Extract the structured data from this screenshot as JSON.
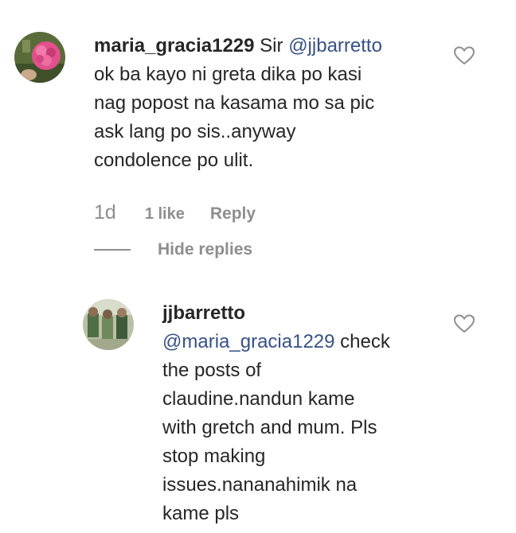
{
  "comments": [
    {
      "username": "maria_gracia1229",
      "mention": "@jjbarretto",
      "prefix": "Sir",
      "body_after_mention_lines": [
        "ok ba kayo ni greta dika po kasi",
        "nag popost na kasama mo sa pic",
        "ask lang po sis..anyway",
        "condolence po ulit."
      ],
      "time": "1d",
      "likes": "1 like",
      "reply_label": "Reply",
      "hide_replies_label": "Hide replies",
      "avatar_icon": "pink-flower-photo"
    },
    {
      "username": "jjbarretto",
      "mention": "@maria_gracia1229",
      "first_line_after_mention": "check",
      "body_lines": [
        "the posts of",
        "claudine.nandun kame",
        "with gretch and mum. Pls",
        "stop making",
        "issues.nananahimik na",
        "kame pls"
      ],
      "avatar_icon": "group-photo"
    }
  ],
  "icons": {
    "like": "heart-outline-icon"
  },
  "colors": {
    "text": "#262626",
    "mention": "#385185",
    "muted": "#8e8e8e"
  }
}
